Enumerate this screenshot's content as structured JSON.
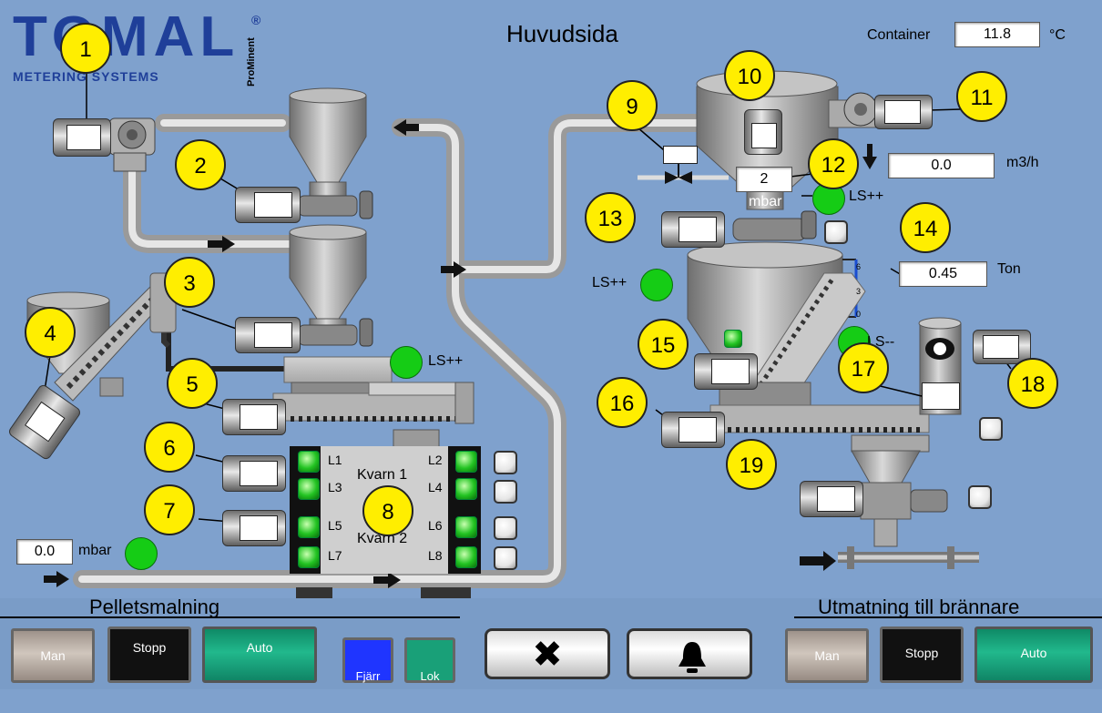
{
  "logo": {
    "brand": "TOMAL",
    "sub": "METERING SYSTEMS",
    "side": "ProMinent"
  },
  "header": {
    "title": "Huvudsida"
  },
  "container": {
    "label": "Container",
    "value": "11.8",
    "unit": "°C"
  },
  "flow": {
    "value": "0.0",
    "unit": "m3/h"
  },
  "pressure_mid": {
    "value": "2",
    "unit": "mbar"
  },
  "weight": {
    "value": "0.45",
    "unit": "Ton",
    "scale": [
      "6",
      "3",
      "0"
    ]
  },
  "pressure_bottom": {
    "value": "0.0",
    "unit": "mbar"
  },
  "mill": {
    "kvarn1": "Kvarn 1",
    "kvarn2": "Kvarn 2",
    "lights": [
      "L1",
      "L2",
      "L3",
      "L4",
      "L5",
      "L6",
      "L7",
      "L8"
    ]
  },
  "level_labels": {
    "ls_top_left": "LS++",
    "ls_right_a": "LS++",
    "ls_right_b": "LS++",
    "ls_right_c": "LS--"
  },
  "badges": [
    "1",
    "2",
    "3",
    "4",
    "5",
    "6",
    "7",
    "8",
    "9",
    "10",
    "11",
    "12",
    "13",
    "14",
    "15",
    "16",
    "17",
    "18",
    "19"
  ],
  "sections": {
    "left": "Pelletsmalning",
    "right": "Utmatning till brännare"
  },
  "left_buttons": {
    "man": "Man",
    "stop": "Stopp",
    "auto": "Auto"
  },
  "mode_buttons": {
    "remote": "Fjärr",
    "local": "Lok"
  },
  "tools": {
    "settings_icon": "wrench-screwdriver-icon",
    "alarm_icon": "bell-icon"
  },
  "right_buttons": {
    "man": "Man",
    "stop": "Stopp",
    "auto": "Auto"
  },
  "colors": {
    "background": "#7fa1cd",
    "badge": "#ffee00",
    "indicator_on": "#22c322",
    "auto": "#19a078",
    "pipe": "#c8c8c8"
  }
}
